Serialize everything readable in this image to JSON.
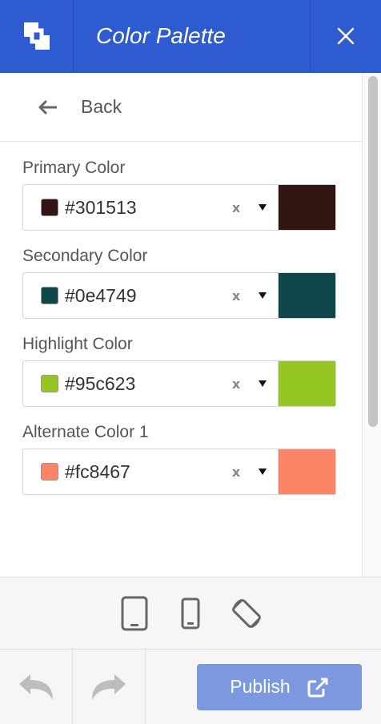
{
  "header": {
    "title": "Color Palette",
    "logo_icon": "customizer-logo-icon",
    "close_icon": "close-icon",
    "background": "#2f5bd0"
  },
  "nav": {
    "back_label": "Back",
    "back_icon": "arrow-left-icon"
  },
  "fields": [
    {
      "label": "Primary Color",
      "value": "#301513",
      "color": "#301513"
    },
    {
      "label": "Secondary Color",
      "value": "#0e4749",
      "color": "#0e4749"
    },
    {
      "label": "Highlight Color",
      "value": "#95c623",
      "color": "#95c623"
    },
    {
      "label": "Alternate Color 1",
      "value": "#fc8467",
      "color": "#fc8467"
    }
  ],
  "clear_glyph": "x",
  "devices": {
    "tablet_icon": "tablet-icon",
    "mobile_icon": "mobile-icon",
    "rotate_icon": "rotate-device-icon"
  },
  "footer": {
    "undo_icon": "undo-icon",
    "redo_icon": "redo-icon",
    "publish_label": "Publish",
    "publish_icon": "external-link-icon",
    "publish_color": "#7c98e0"
  }
}
